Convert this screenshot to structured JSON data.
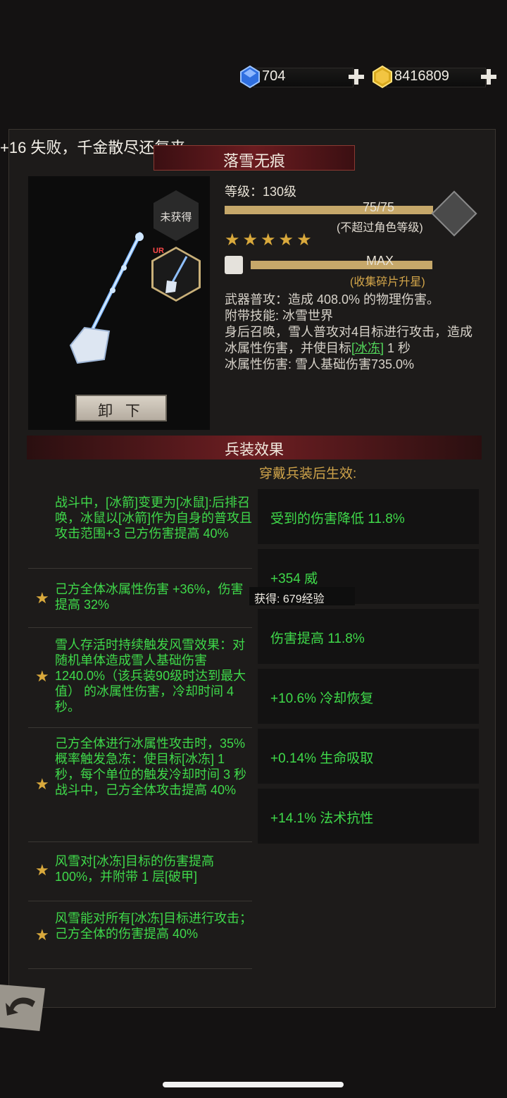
{
  "currency": {
    "gems": "704",
    "gold": "8416809"
  },
  "marquee": "+16 失败，千金散尽还复来",
  "weapon": {
    "name": "落雪无痕",
    "status": "未获得",
    "rarity": "UR",
    "unequip_label": "卸 下",
    "level_label": "等级：130级",
    "level_progress": "75/75",
    "level_note": "(不超过角色等级)",
    "stars": 5,
    "shard_progress": "MAX",
    "shard_note": "(收集碎片升星)",
    "desc_line1": "武器普攻：造成 408.0% 的物理伤害。",
    "desc_line2": "附带技能: 冰雪世界",
    "desc_line3a": "身后召唤，雪人普攻对4目标进行攻击，造成冰属性伤害，并使目标",
    "desc_link": "[冰冻]",
    "desc_line3b": "1 秒",
    "desc_line4": "冰属性伤害: 雪人基础伤害735.0%"
  },
  "section_title": "兵装效果",
  "equip_subtitle": "穿戴兵装后生效:",
  "effects": [
    {
      "text": "战斗中，[冰箭]变更为[冰鼠]:后排召唤，冰鼠以[冰箭]作为自身的普攻且攻击范围+3 己方伤害提高 40%",
      "star": false
    },
    {
      "text": "己方全体冰属性伤害 +36%，伤害提高 32%",
      "star": true
    },
    {
      "text": "雪人存活时持续触发风雪效果：对随机单体造成雪人基础伤害 1240.0%（该兵装90级时达到最大值） 的冰属性伤害，冷却时间 4 秒。",
      "star": true
    },
    {
      "text": "己方全体进行冰属性攻击时，35% 概率触发急冻：使目标[冰冻] 1 秒，每个单位的触发冷却时间 3 秒 战斗中，己方全体攻击提高 40%",
      "star": true
    },
    {
      "text": "风雪对[冰冻]目标的伤害提高 100%，并附带 1 层[破甲]",
      "star": true
    },
    {
      "text": "风雪能对所有[冰冻]目标进行攻击；己方全体的伤害提高 40%",
      "star": true
    }
  ],
  "stats": [
    "受到的伤害降低 11.8%",
    "+354 威",
    "伤害提高 11.8%",
    "+10.6% 冷却恢复",
    "+0.14% 生命吸取",
    "+14.1% 法术抗性"
  ],
  "toast": "获得: 679经验"
}
